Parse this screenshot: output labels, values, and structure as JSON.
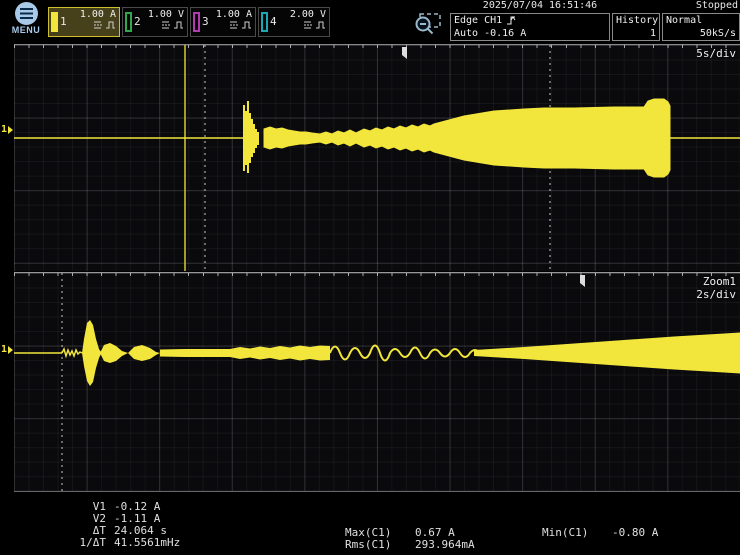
{
  "header": {
    "menu_label": "MENU",
    "channels": [
      {
        "id": "1",
        "value": "1.00 A"
      },
      {
        "id": "2",
        "value": "1.00 V"
      },
      {
        "id": "3",
        "value": "1.00 A"
      },
      {
        "id": "4",
        "value": "2.00 V"
      }
    ],
    "datetime": "2025/07/04 16:51:46",
    "status": "Stopped",
    "trigger_line1": "Edge CH1",
    "trigger_line2": "Auto -0.16 A",
    "history_label": "History",
    "history_value": "1",
    "acq_mode": "Normal",
    "sample_rate": "50kS/s"
  },
  "main_window": {
    "timebase": "5s/div",
    "channel_marker": "1"
  },
  "zoom_window": {
    "label": "Zoom1",
    "timebase": "2s/div",
    "channel_marker": "1"
  },
  "measurements": {
    "rows": [
      {
        "label": "V1",
        "value": "-0.12 A"
      },
      {
        "label": "V2",
        "value": "-1.11 A"
      },
      {
        "label": "ΔT",
        "value": "24.064 s"
      },
      {
        "label": "1/ΔT",
        "value": "41.5561mHz"
      }
    ],
    "max_label": "Max(C1)",
    "max_value": "0.67 A",
    "rms_label": "Rms(C1)",
    "rms_value": "293.964mA",
    "min_label": "Min(C1)",
    "min_value": "-0.80 A"
  },
  "colors": {
    "waveform": "#f2e63c",
    "ch1": "#f2e63c",
    "ch2": "#2fa84f",
    "ch3": "#b13ab1",
    "ch4": "#19a8b4",
    "accent_blue": "#a9c9e9"
  }
}
